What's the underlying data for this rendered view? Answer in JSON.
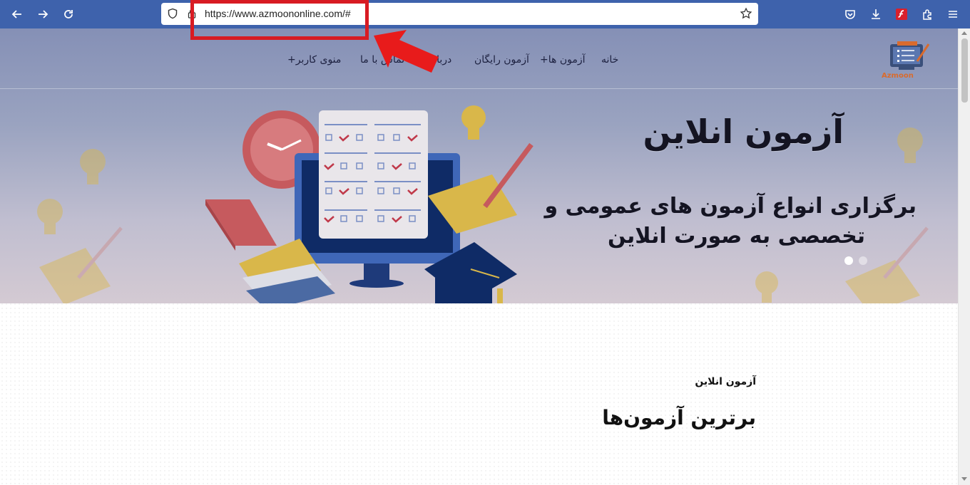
{
  "browser": {
    "url": "https://www.azmoononline.com/#",
    "icons": [
      "back-icon",
      "forward-icon",
      "reload-icon",
      "shield-icon",
      "lock-icon",
      "star-icon",
      "pocket-icon",
      "download-icon",
      "flash-icon",
      "extensions-icon",
      "menu-icon"
    ]
  },
  "nav": {
    "home": "خانه",
    "exams": "آزمون ها+",
    "free_exam": "آزمون رایگان",
    "about": "درباره",
    "contact": "تماس با ما",
    "user_menu": "منوی کاربر+"
  },
  "logo": {
    "text": "Azmoon"
  },
  "hero": {
    "title": "آزمون انلاین",
    "subtitle_line1": "برگزاری انواع آزمون های عمومی و",
    "subtitle_line2": "تخصصی به صورت  انلاین",
    "slides": 2,
    "active_slide": 1
  },
  "section": {
    "label": "آزمون انلاین",
    "title": "برترین آزمون‌ها"
  },
  "colors": {
    "toolbar": "#3e62ac",
    "annotation": "#d81b23"
  }
}
